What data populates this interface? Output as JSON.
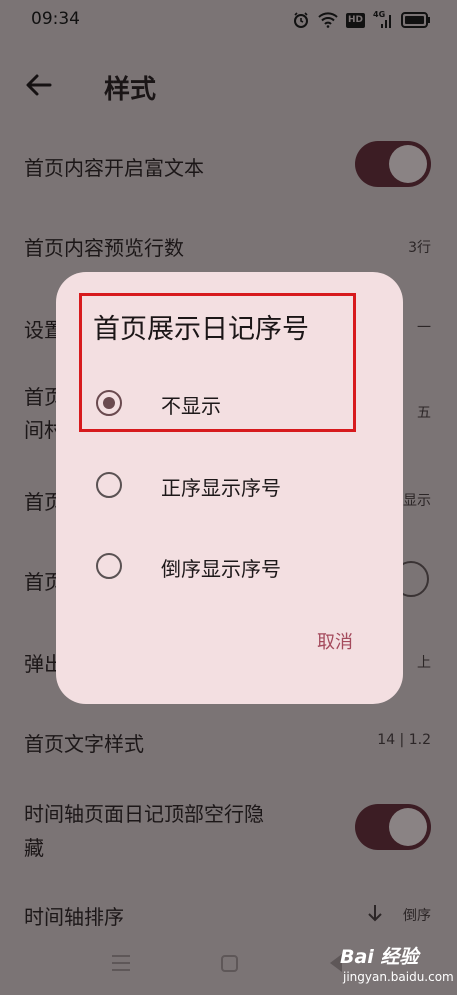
{
  "status_bar": {
    "time": "09:34",
    "hd_badge": "HD",
    "network_label": "4G"
  },
  "app_bar": {
    "title": "样式"
  },
  "settings": [
    {
      "label": "首页内容开启富文本"
    },
    {
      "label": "首页内容预览行数",
      "value": "3行"
    },
    {
      "label": "设置",
      "value": "一"
    },
    {
      "label": "首页",
      "label_line2": "间村",
      "value": "五"
    },
    {
      "label": "首页",
      "value": "显示"
    },
    {
      "label": "首页"
    },
    {
      "label": "弹出",
      "value": "上"
    },
    {
      "label": "首页文字样式",
      "value": "14 | 1.2"
    },
    {
      "label": "时间轴页面日记顶部空行隐",
      "label_line2": "藏"
    },
    {
      "label": "时间轴排序",
      "value": "倒序"
    }
  ],
  "dialog": {
    "title": "首页展示日记序号",
    "options": [
      {
        "label": "不显示",
        "selected": true
      },
      {
        "label": "正序显示序号",
        "selected": false
      },
      {
        "label": "倒序显示序号",
        "selected": false
      }
    ],
    "cancel_label": "取消"
  },
  "watermark": {
    "brand": "Bai 经验",
    "url": "jingyan.baidu.com"
  },
  "colors": {
    "accent": "#a44a5c",
    "toggle_on": "#3c1d24",
    "dialog_bg": "#f3dfe1",
    "highlight": "#d71a1d"
  }
}
